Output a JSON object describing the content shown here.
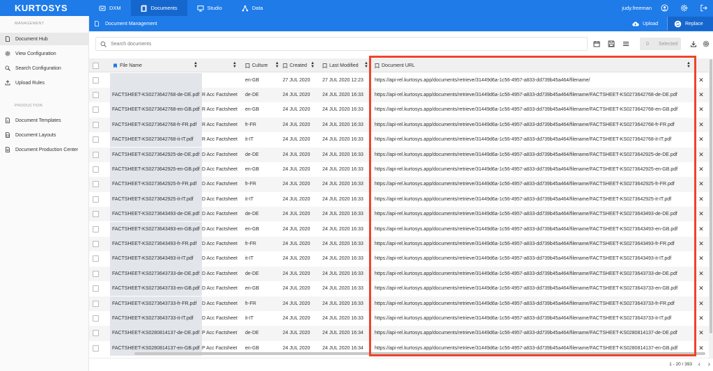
{
  "app": {
    "logo": "KURTOSYS",
    "user": "judy.freeman"
  },
  "nav": [
    {
      "label": "DXM",
      "icon": "dxm-icon"
    },
    {
      "label": "Documents",
      "icon": "documents-icon",
      "active": true
    },
    {
      "label": "Studio",
      "icon": "studio-icon"
    },
    {
      "label": "Data",
      "icon": "data-icon"
    }
  ],
  "sidebar": {
    "management_title": "MANAGEMENT",
    "production_title": "PRODUCTION",
    "management": [
      {
        "label": "Document Hub",
        "icon": "document-icon",
        "active": true
      },
      {
        "label": "View Configuration",
        "icon": "gear-icon"
      },
      {
        "label": "Search Configuration",
        "icon": "search-icon"
      },
      {
        "label": "Upload Rules",
        "icon": "upload-icon"
      }
    ],
    "production": [
      {
        "label": "Document Templates",
        "icon": "template-icon"
      },
      {
        "label": "Document Layouts",
        "icon": "layout-icon"
      },
      {
        "label": "Document Production Center",
        "icon": "production-icon"
      }
    ]
  },
  "subheader": {
    "title": "Document Management",
    "upload": "Upload",
    "replace": "Replace"
  },
  "toolbar": {
    "search_placeholder": "Search documents",
    "selected_count": "0",
    "selected_label": "Selected"
  },
  "table": {
    "columns": {
      "file_name": "File Name",
      "culture": "Culture",
      "created": "Created",
      "last_modified": "Last Modified",
      "document_url": "Document URL"
    },
    "rows": [
      {
        "file": "",
        "title": "",
        "culture": "en-GB",
        "created": "27 JUL 2020",
        "modified": "27 JUL 2020 12:23",
        "url": "https://api-rel.kurtosys.app/documents/retrieve/31449d6a-1c56-4957-a833-dd739b45a464/filename/"
      },
      {
        "file": "FACTSHEET-KS0273642768-de-DE.pdf",
        "title": "R Acc Factsheet",
        "culture": "de-DE",
        "created": "24 JUL 2020",
        "modified": "24 JUL 2020 16:33",
        "url": "https://api-rel.kurtosys.app/documents/retrieve/31449d6a-1c56-4957-a833-dd739b45a464/filename/FACTSHEET-KS0273642768-de-DE.pdf"
      },
      {
        "file": "FACTSHEET-KS0273642768-en-GB.pdf",
        "title": "R Acc Factsheet",
        "culture": "en-GB",
        "created": "24 JUL 2020",
        "modified": "24 JUL 2020 16:33",
        "url": "https://api-rel.kurtosys.app/documents/retrieve/31449d6a-1c56-4957-a833-dd739b45a464/filename/FACTSHEET-KS0273642768-en-GB.pdf"
      },
      {
        "file": "FACTSHEET-KS0273642768-fr-FR.pdf",
        "title": "R Acc Factsheet",
        "culture": "fr-FR",
        "created": "24 JUL 2020",
        "modified": "24 JUL 2020 16:33",
        "url": "https://api-rel.kurtosys.app/documents/retrieve/31449d6a-1c56-4957-a833-dd739b45a464/filename/FACTSHEET-KS0273642768-fr-FR.pdf"
      },
      {
        "file": "FACTSHEET-KS0273642768-it-IT.pdf",
        "title": "R Acc Factsheet",
        "culture": "it-IT",
        "created": "24 JUL 2020",
        "modified": "24 JUL 2020 16:33",
        "url": "https://api-rel.kurtosys.app/documents/retrieve/31449d6a-1c56-4957-a833-dd739b45a464/filename/FACTSHEET-KS0273642768-it-IT.pdf"
      },
      {
        "file": "FACTSHEET-KS0273642925-de-DE.pdf",
        "title": "D Acc Factsheet",
        "culture": "de-DE",
        "created": "24 JUL 2020",
        "modified": "24 JUL 2020 16:33",
        "url": "https://api-rel.kurtosys.app/documents/retrieve/31449d6a-1c56-4957-a833-dd739b45a464/filename/FACTSHEET-KS0273642925-de-DE.pdf"
      },
      {
        "file": "FACTSHEET-KS0273642925-en-GB.pdf",
        "title": "D Acc Factsheet",
        "culture": "en-GB",
        "created": "24 JUL 2020",
        "modified": "24 JUL 2020 16:33",
        "url": "https://api-rel.kurtosys.app/documents/retrieve/31449d6a-1c56-4957-a833-dd739b45a464/filename/FACTSHEET-KS0273642925-en-GB.pdf"
      },
      {
        "file": "FACTSHEET-KS0273642925-fr-FR.pdf",
        "title": "D Acc Factsheet",
        "culture": "fr-FR",
        "created": "24 JUL 2020",
        "modified": "24 JUL 2020 16:33",
        "url": "https://api-rel.kurtosys.app/documents/retrieve/31449d6a-1c56-4957-a833-dd739b45a464/filename/FACTSHEET-KS0273642925-fr-FR.pdf"
      },
      {
        "file": "FACTSHEET-KS0273642925-it-IT.pdf",
        "title": "D Acc Factsheet",
        "culture": "it-IT",
        "created": "24 JUL 2020",
        "modified": "24 JUL 2020 16:33",
        "url": "https://api-rel.kurtosys.app/documents/retrieve/31449d6a-1c56-4957-a833-dd739b45a464/filename/FACTSHEET-KS0273642925-it-IT.pdf"
      },
      {
        "file": "FACTSHEET-KS0273643493-de-DE.pdf",
        "title": "D Acc Factsheet",
        "culture": "de-DE",
        "created": "24 JUL 2020",
        "modified": "24 JUL 2020 16:33",
        "url": "https://api-rel.kurtosys.app/documents/retrieve/31449d6a-1c56-4957-a833-dd739b45a464/filename/FACTSHEET-KS0273643493-de-DE.pdf"
      },
      {
        "file": "FACTSHEET-KS0273643493-en-GB.pdf",
        "title": "D Acc Factsheet",
        "culture": "en-GB",
        "created": "24 JUL 2020",
        "modified": "24 JUL 2020 16:33",
        "url": "https://api-rel.kurtosys.app/documents/retrieve/31449d6a-1c56-4957-a833-dd739b45a464/filename/FACTSHEET-KS0273643493-en-GB.pdf"
      },
      {
        "file": "FACTSHEET-KS0273643493-fr-FR.pdf",
        "title": "D Acc Factsheet",
        "culture": "fr-FR",
        "created": "24 JUL 2020",
        "modified": "24 JUL 2020 16:33",
        "url": "https://api-rel.kurtosys.app/documents/retrieve/31449d6a-1c56-4957-a833-dd739b45a464/filename/FACTSHEET-KS0273643493-fr-FR.pdf"
      },
      {
        "file": "FACTSHEET-KS0273643493-it-IT.pdf",
        "title": "D Acc Factsheet",
        "culture": "it-IT",
        "created": "24 JUL 2020",
        "modified": "24 JUL 2020 16:33",
        "url": "https://api-rel.kurtosys.app/documents/retrieve/31449d6a-1c56-4957-a833-dd739b45a464/filename/FACTSHEET-KS0273643493-it-IT.pdf"
      },
      {
        "file": "FACTSHEET-KS0273643733-de-DE.pdf",
        "title": "D Acc Factsheet",
        "culture": "de-DE",
        "created": "24 JUL 2020",
        "modified": "24 JUL 2020 16:33",
        "url": "https://api-rel.kurtosys.app/documents/retrieve/31449d6a-1c56-4957-a833-dd739b45a464/filename/FACTSHEET-KS0273643733-de-DE.pdf"
      },
      {
        "file": "FACTSHEET-KS0273643733-en-GB.pdf",
        "title": "D Acc Factsheet",
        "culture": "en-GB",
        "created": "24 JUL 2020",
        "modified": "24 JUL 2020 16:33",
        "url": "https://api-rel.kurtosys.app/documents/retrieve/31449d6a-1c56-4957-a833-dd739b45a464/filename/FACTSHEET-KS0273643733-en-GB.pdf"
      },
      {
        "file": "FACTSHEET-KS0273643733-fr-FR.pdf",
        "title": "D Acc Factsheet",
        "culture": "fr-FR",
        "created": "24 JUL 2020",
        "modified": "24 JUL 2020 16:33",
        "url": "https://api-rel.kurtosys.app/documents/retrieve/31449d6a-1c56-4957-a833-dd739b45a464/filename/FACTSHEET-KS0273643733-fr-FR.pdf"
      },
      {
        "file": "FACTSHEET-KS0273643733-it-IT.pdf",
        "title": "D Acc Factsheet",
        "culture": "it-IT",
        "created": "24 JUL 2020",
        "modified": "24 JUL 2020 16:33",
        "url": "https://api-rel.kurtosys.app/documents/retrieve/31449d6a-1c56-4957-a833-dd739b45a464/filename/FACTSHEET-KS0273643733-it-IT.pdf"
      },
      {
        "file": "FACTSHEET-KS0280814137-de-DE.pdf",
        "title": "P Acc Factsheet",
        "culture": "de-DE",
        "created": "24 JUL 2020",
        "modified": "24 JUL 2020 16:34",
        "url": "https://api-rel.kurtosys.app/documents/retrieve/31449d6a-1c56-4957-a833-dd739b45a464/filename/FACTSHEET-KS0280814137-de-DE.pdf"
      },
      {
        "file": "FACTSHEET-KS0280814137-en-GB.pdf",
        "title": "P Acc Factsheet",
        "culture": "en-GB",
        "created": "24 JUL 2020",
        "modified": "24 JUL 2020 16:34",
        "url": "https://api-rel.kurtosys.app/documents/retrieve/31449d6a-1c56-4957-a833-dd739b45a464/filename/FACTSHEET-KS0280814137-en-GB.pdf"
      }
    ]
  },
  "footer": {
    "pagination": "1 - 20 / 393"
  },
  "colors": {
    "primary": "#1e7be8",
    "primary_dark": "#1567cd",
    "highlight": "#f0432a",
    "row_alt": "#f5f5f5"
  }
}
